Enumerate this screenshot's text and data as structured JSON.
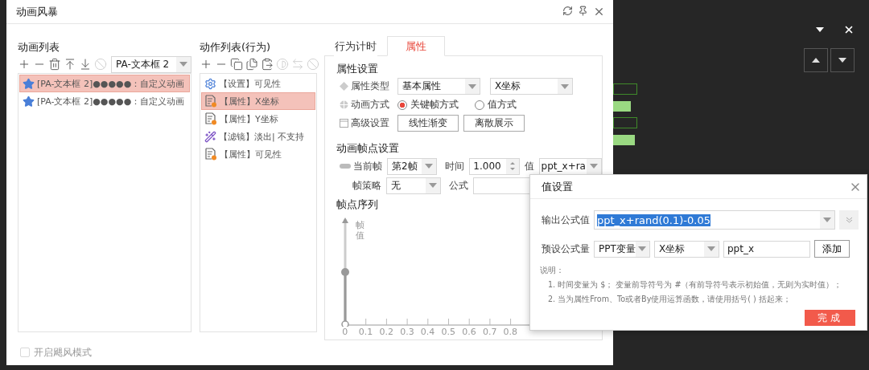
{
  "window": {
    "title": "动画风暴"
  },
  "animation_list": {
    "title": "动画列表",
    "toolbar": [
      {
        "kind": "add",
        "disabled": false
      },
      {
        "kind": "remove",
        "disabled": false
      },
      {
        "kind": "delete",
        "disabled": false
      },
      {
        "kind": "move-top",
        "disabled": false
      },
      {
        "kind": "move-bottom",
        "disabled": false
      },
      {
        "kind": "clear",
        "disabled": true
      }
    ],
    "target_select": "PA-文本框 2",
    "items": [
      {
        "label": "[PA-文本框 2]●●●●●：自定义动画",
        "selected": true
      },
      {
        "label": "[PA-文本框 2]●●●●●：自定义动画",
        "selected": false
      }
    ]
  },
  "action_list": {
    "title": "动作列表(行为)",
    "toolbar": [
      {
        "kind": "add",
        "disabled": false
      },
      {
        "kind": "remove",
        "disabled": false
      },
      {
        "kind": "copy",
        "disabled": false
      },
      {
        "kind": "duplicate",
        "disabled": false
      },
      {
        "kind": "paste",
        "disabled": false
      },
      {
        "kind": "split",
        "disabled": true
      },
      {
        "kind": "swap",
        "disabled": true
      },
      {
        "kind": "clear",
        "disabled": true
      }
    ],
    "items": [
      {
        "kind": "setting",
        "label": "【设置】可见性",
        "selected": false
      },
      {
        "kind": "property",
        "label": "【属性】X坐标",
        "selected": true
      },
      {
        "kind": "property",
        "label": "【属性】Y坐标",
        "selected": false
      },
      {
        "kind": "filter",
        "label": "【滤镜】淡出| 不支持",
        "selected": false
      },
      {
        "kind": "property",
        "label": "【属性】可见性",
        "selected": false
      }
    ]
  },
  "tabs": [
    {
      "label": "行为计时",
      "selected": false
    },
    {
      "label": "属性",
      "selected": true
    }
  ],
  "property_settings": {
    "title": "属性设置",
    "type_label": "属性类型",
    "type_value": "基本属性",
    "property_value": "X坐标",
    "mode_label": "动画方式",
    "modes": [
      {
        "label": "关键帧方式",
        "selected": true
      },
      {
        "label": "值方式",
        "selected": false
      }
    ],
    "advanced_label": "高级设置",
    "advanced_buttons": [
      "线性渐变",
      "离散展示"
    ]
  },
  "keyframe_settings": {
    "title": "动画帧点设置",
    "current_frame_label": "当前帧",
    "current_frame": "第2帧",
    "time_label": "时间",
    "time": "1.000",
    "value_label": "值",
    "value": "ppt_x+ra",
    "strategy_label": "帧策略",
    "strategy": "无",
    "formula_label": "公式"
  },
  "frame_sequence": {
    "title": "帧点序列",
    "y_label": "帧值",
    "x_ticks": [
      "0",
      "0.1",
      "0.2",
      "0.3",
      "0.4",
      "0.5",
      "0.6",
      "0.7",
      "0.8"
    ]
  },
  "hurricane_mode": {
    "label": "开启飓风模式",
    "checked": false
  },
  "value_dialog": {
    "title": "值设置",
    "output_label": "输出公式值",
    "output_value": "ppt_x+rand(0.1)-0.05",
    "preset_label": "预设公式量",
    "preset_source": "PPT变量",
    "preset_property": "X坐标",
    "preset_variable": "ppt_x",
    "add_button": "添加",
    "notes_title": "说明：",
    "notes": [
      "1. 时间变量为 $； 变量前导符号为 #（有前导符号表示初始值，无则为实时值）；",
      "2. 当为属性From、To或者By使用运算函数，请使用括号( ) 括起来；"
    ],
    "done_button": "完成"
  }
}
